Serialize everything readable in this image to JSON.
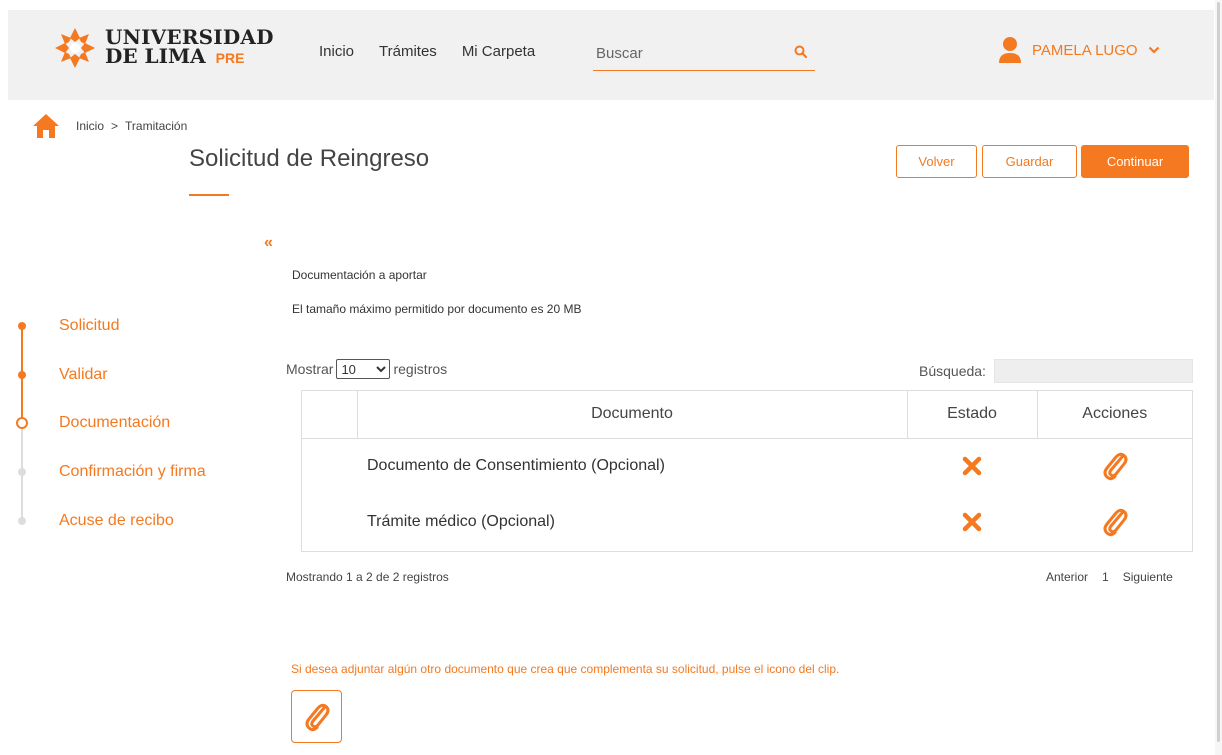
{
  "header": {
    "logo": {
      "line1": "UNIVERSIDAD",
      "line2": "DE LIMA",
      "tag": "PRE"
    },
    "nav": [
      "Inicio",
      "Trámites",
      "Mi Carpeta"
    ],
    "search": {
      "placeholder": "Buscar",
      "value": ""
    },
    "user": {
      "name": "PAMELA LUGO"
    }
  },
  "breadcrumb": {
    "items": [
      "Inicio",
      "Tramitación"
    ],
    "separator": ">"
  },
  "page": {
    "title": "Solicitud de Reingreso",
    "buttons": {
      "volver": "Volver",
      "guardar": "Guardar",
      "continuar": "Continuar"
    },
    "collapse_glyph": "«",
    "doc_heading": "Documentación a aportar",
    "doc_size_note": "El tamaño máximo permitido por documento es 20 MB"
  },
  "steps": [
    {
      "label": "Solicitud",
      "state": "done"
    },
    {
      "label": "Validar",
      "state": "done"
    },
    {
      "label": "Documentación",
      "state": "current"
    },
    {
      "label": "Confirmación y firma",
      "state": "pending"
    },
    {
      "label": "Acuse de recibo",
      "state": "pending"
    }
  ],
  "table": {
    "show_prefix": "Mostrar",
    "show_value": "10",
    "show_suffix": "registros",
    "search_label": "Búsqueda:",
    "search_value": "",
    "columns": [
      "",
      "Documento",
      "Estado",
      "Acciones"
    ],
    "rows": [
      {
        "document": "Documento de Consentimiento (Opcional)",
        "estado_icon": "x-icon",
        "accion_icon": "paperclip-icon"
      },
      {
        "document": "Trámite médico (Opcional)",
        "estado_icon": "x-icon",
        "accion_icon": "paperclip-icon"
      }
    ],
    "info": "Mostrando 1 a 2 de 2 registros",
    "pager": {
      "prev": "Anterior",
      "page": "1",
      "next": "Siguiente"
    }
  },
  "extra": {
    "note": "Si desea adjuntar algún otro documento que crea que complementa su solicitud, pulse el icono del clip."
  },
  "colors": {
    "accent": "#f47920",
    "header_bg": "#f1f1f2"
  }
}
